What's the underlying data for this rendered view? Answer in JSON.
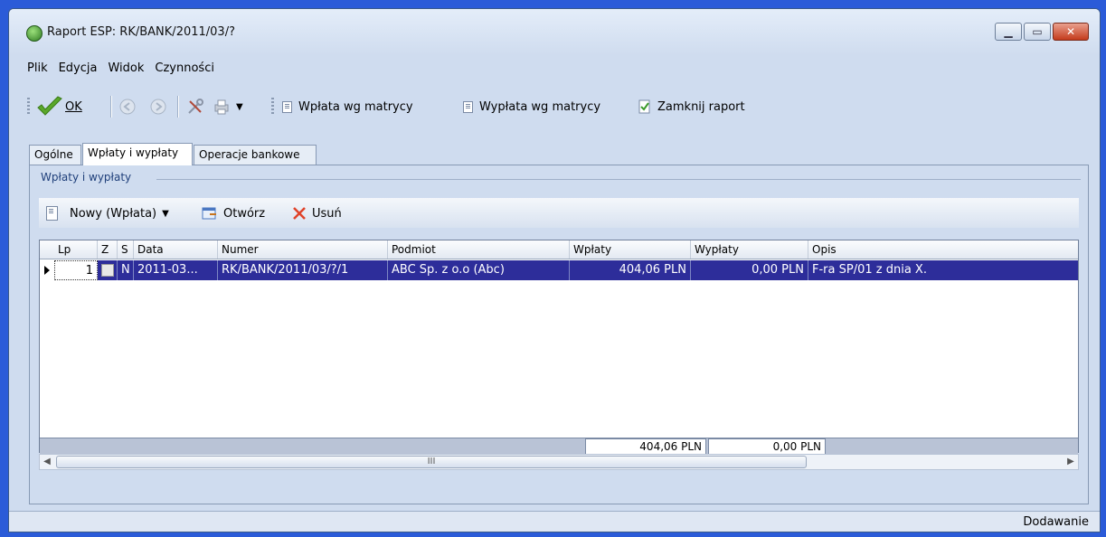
{
  "window": {
    "title": "Raport ESP: RK/BANK/2011/03/?",
    "controls": [
      "minimize-icon",
      "maximize-icon",
      "close-icon"
    ]
  },
  "menu": [
    "Plik",
    "Edycja",
    "Widok",
    "Czynności"
  ],
  "toolbar": {
    "ok_label": "OK",
    "wplata_matrycy": "Wpłata wg matrycy",
    "wyplata_matrycy": "Wypłata wg matrycy",
    "zamknij_raport": "Zamknij raport"
  },
  "tabs": [
    {
      "label": "Ogólne"
    },
    {
      "label": "Wpłaty i wypłaty",
      "active": true
    },
    {
      "label": "Operacje bankowe"
    }
  ],
  "group_title": "Wpłaty i wypłaty",
  "grid_toolbar": {
    "new_label": "Nowy (Wpłata)",
    "open_label": "Otwórz",
    "delete_label": "Usuń"
  },
  "columns": [
    "Lp",
    "Z",
    "S",
    "Data",
    "Numer",
    "Podmiot",
    "Wpłaty",
    "Wypłaty",
    "Opis"
  ],
  "rows": [
    {
      "lp": "1",
      "z": "",
      "s": "N",
      "data": "2011-03...",
      "numer": "RK/BANK/2011/03/?/1",
      "podmiot": "ABC Sp. z o.o (Abc)",
      "wplaty": "404,06 PLN",
      "wyplaty": "0,00 PLN",
      "opis": "F-ra SP/01 z dnia X."
    }
  ],
  "totals": {
    "wplaty": "404,06 PLN",
    "wyplaty": "0,00 PLN"
  },
  "scrollbar_thumb_grip": "III",
  "status": "Dodawanie",
  "colors": {
    "selected_row": "#2d2d9a",
    "accent": "#2b5bd8"
  }
}
